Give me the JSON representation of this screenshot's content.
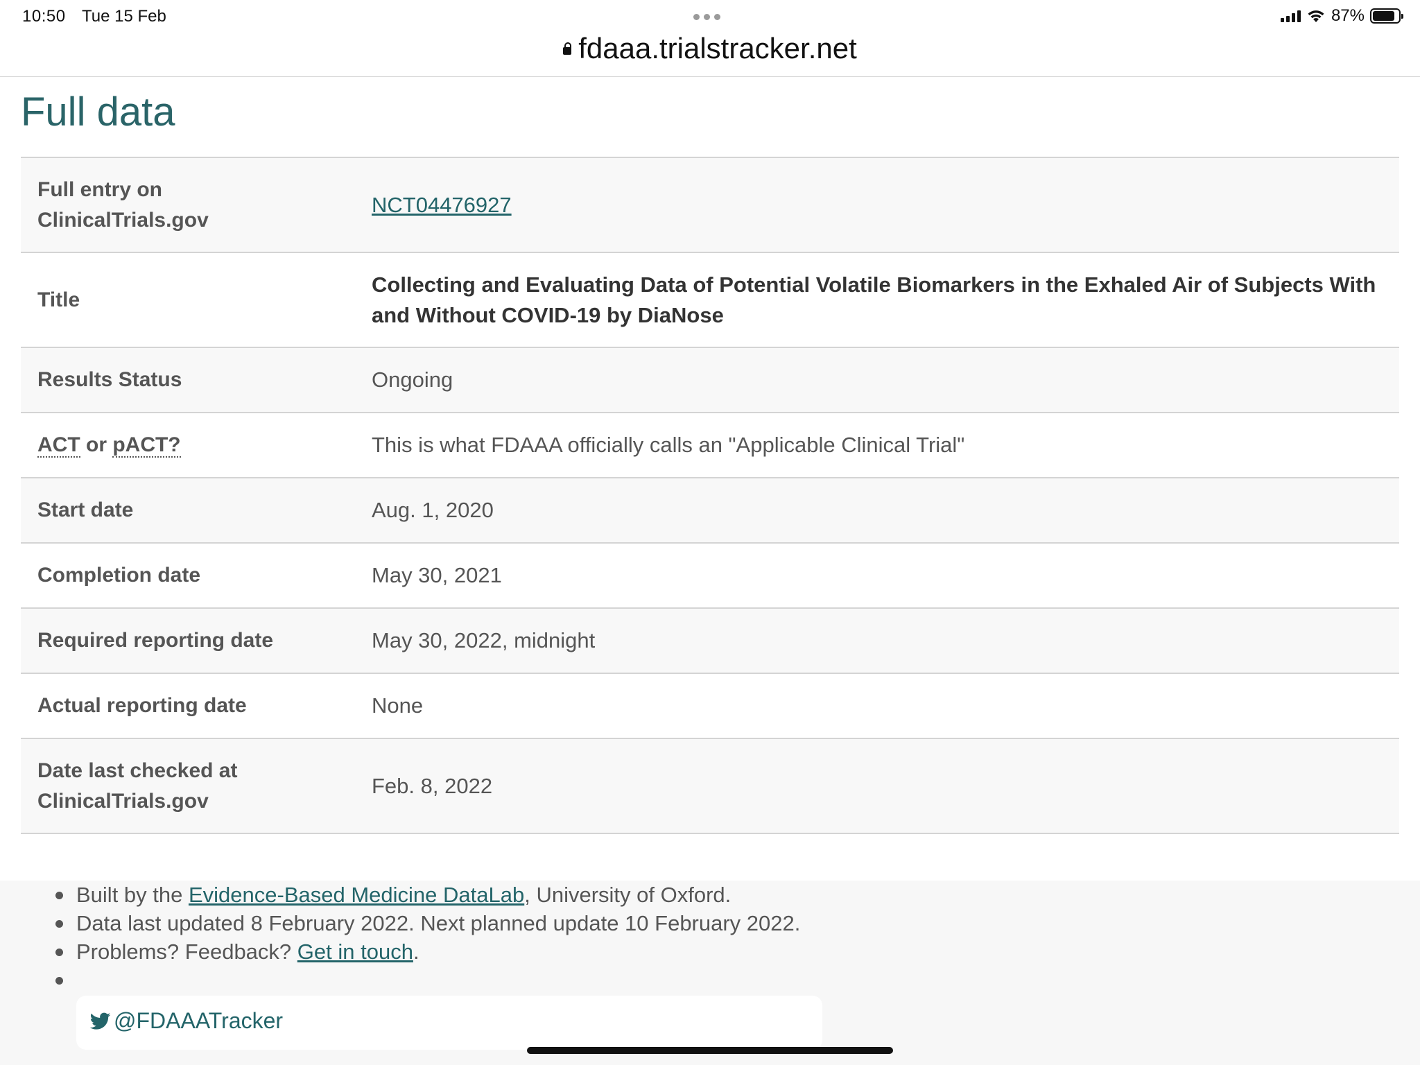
{
  "status_bar": {
    "time": "10:50",
    "date": "Tue 15 Feb",
    "battery_percent_label": "87%",
    "battery_level": 0.87
  },
  "browser": {
    "url": "fdaaa.trialstracker.net"
  },
  "page": {
    "title": "Full data",
    "rows": [
      {
        "label": "Full entry on ClinicalTrials.gov",
        "value": "NCT04476927"
      },
      {
        "label": "Title",
        "value": "Collecting and Evaluating Data of Potential Volatile Biomarkers in the Exhaled Air of Subjects With and Without COVID-19 by DiaNose"
      },
      {
        "label": "Results Status",
        "value": "Ongoing"
      },
      {
        "label_part1": "ACT",
        "label_mid": " or ",
        "label_part2": "pACT?",
        "value": "This is what FDAAA officially calls an \"Applicable Clinical Trial\""
      },
      {
        "label": "Start date",
        "value": "Aug. 1, 2020"
      },
      {
        "label": "Completion date",
        "value": "May 30, 2021"
      },
      {
        "label": "Required reporting date",
        "value": "May 30, 2022, midnight"
      },
      {
        "label": "Actual reporting date",
        "value": "None"
      },
      {
        "label": "Date last checked at ClinicalTrials.gov",
        "value": "Feb. 8, 2022"
      }
    ]
  },
  "footer": {
    "line1_prefix": "Built by the ",
    "line1_link": "Evidence-Based Medicine DataLab",
    "line1_suffix": ", University of Oxford.",
    "line2": "Data last updated 8 February 2022. Next planned update 10 February 2022.",
    "line3_prefix": "Problems? Feedback? ",
    "line3_link": "Get in touch",
    "line3_suffix": ".",
    "twitter_handle": "@FDAAATracker"
  }
}
